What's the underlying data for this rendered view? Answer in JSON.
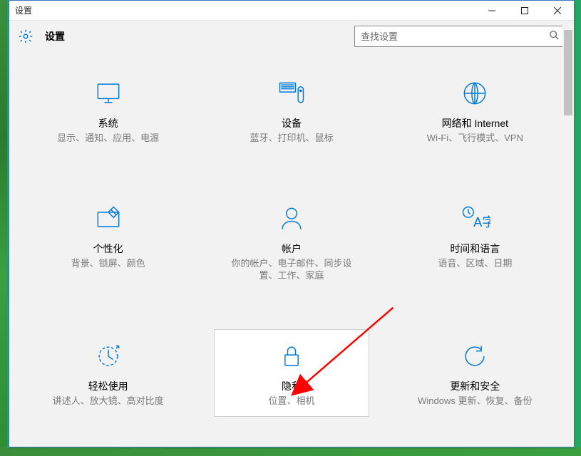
{
  "window": {
    "title": "设置"
  },
  "header": {
    "title": "设置"
  },
  "search": {
    "placeholder": "查找设置"
  },
  "tiles": {
    "system": {
      "title": "系统",
      "desc": "显示、通知、应用、电源"
    },
    "devices": {
      "title": "设备",
      "desc": "蓝牙、打印机、鼠标"
    },
    "network": {
      "title": "网络和 Internet",
      "desc": "Wi-Fi、飞行模式、VPN"
    },
    "personalize": {
      "title": "个性化",
      "desc": "背景、锁屏、颜色"
    },
    "accounts": {
      "title": "帐户",
      "desc": "你的帐户、电子邮件、同步设置、工作、家庭"
    },
    "timelang": {
      "title": "时间和语言",
      "desc": "语音、区域、日期"
    },
    "ease": {
      "title": "轻松使用",
      "desc": "讲述人、放大镜、高对比度"
    },
    "privacy": {
      "title": "隐私",
      "desc": "位置、相机"
    },
    "update": {
      "title": "更新和安全",
      "desc": "Windows 更新、恢复、备份"
    }
  }
}
